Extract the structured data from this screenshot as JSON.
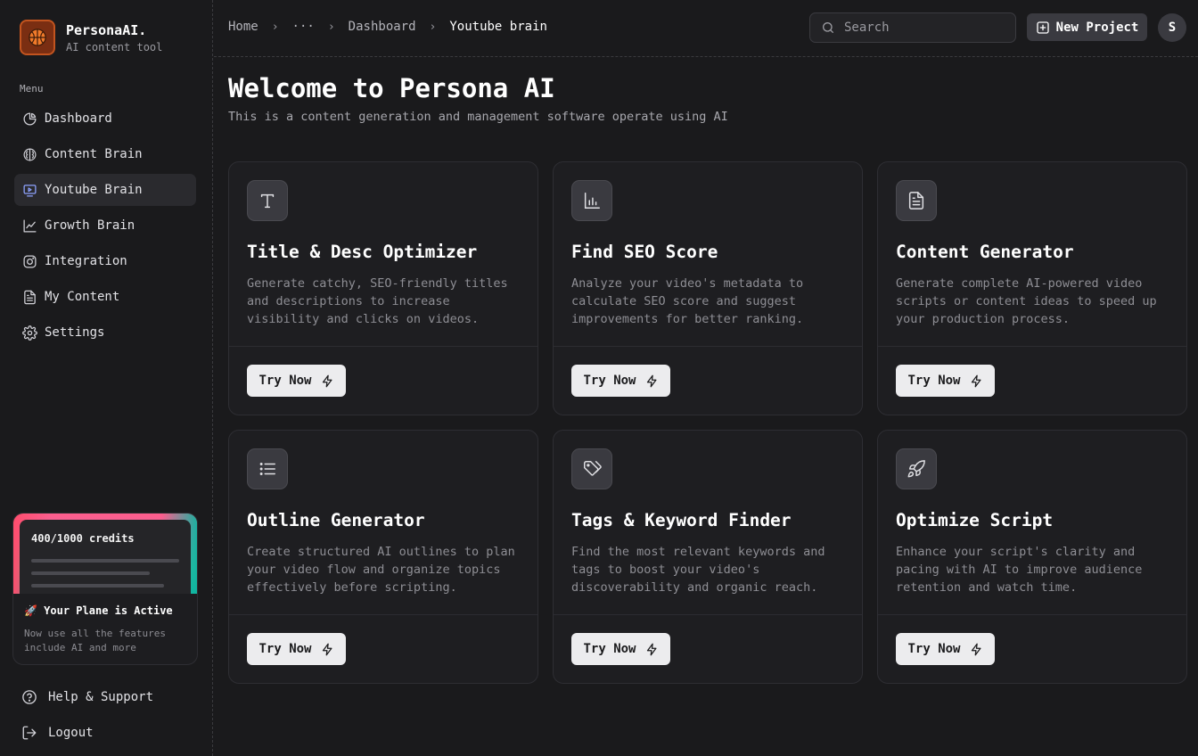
{
  "brand": {
    "name": "PersonaAI.",
    "subtitle": "AI content tool"
  },
  "sidebar": {
    "menu_heading": "Menu",
    "items": [
      {
        "label": "Dashboard",
        "icon": "pie-chart-icon",
        "active": false
      },
      {
        "label": "Content Brain",
        "icon": "brain-icon",
        "active": false
      },
      {
        "label": "Youtube Brain",
        "icon": "video-screen-icon",
        "active": true
      },
      {
        "label": "Growth Brain",
        "icon": "line-chart-icon",
        "active": false
      },
      {
        "label": "Integration",
        "icon": "instagram-icon",
        "active": false
      },
      {
        "label": "My Content",
        "icon": "document-icon",
        "active": false
      },
      {
        "label": "Settings",
        "icon": "gear-icon",
        "active": false
      }
    ],
    "credits": {
      "label": "400/1000 credits",
      "used_fraction": 0.4,
      "plan_title": "🚀 Your Plane is Active",
      "plan_desc": "Now use all the features include AI and more"
    },
    "bottom_items": [
      {
        "label": "Help & Support",
        "icon": "help-circle-icon"
      },
      {
        "label": "Logout",
        "icon": "logout-icon"
      }
    ]
  },
  "header": {
    "breadcrumb": [
      "Home",
      "···",
      "Dashboard",
      "Youtube brain"
    ],
    "search_placeholder": "Search",
    "new_project_label": "New Project",
    "avatar_initial": "S"
  },
  "main": {
    "title": "Welcome to Persona AI",
    "subtitle": "This is a content generation and management software operate using AI",
    "try_label": "Try Now",
    "cards": [
      {
        "title": "Title & Desc Optimizer",
        "desc": "Generate catchy, SEO-friendly titles and descriptions to increase visibility and clicks on videos.",
        "icon": "text-t-icon"
      },
      {
        "title": "Find SEO Score",
        "desc": "Analyze your video's metadata to calculate SEO score and suggest improvements for better ranking.",
        "icon": "bar-chart-icon"
      },
      {
        "title": "Content Generator",
        "desc": "Generate complete AI-powered video scripts or content ideas to speed up your production process.",
        "icon": "file-text-icon"
      },
      {
        "title": "Outline Generator",
        "desc": "Create structured AI outlines to plan your video flow and organize topics effectively before scripting.",
        "icon": "list-icon"
      },
      {
        "title": "Tags & Keyword Finder",
        "desc": "Find the most relevant keywords and tags to boost your video's discoverability and organic reach.",
        "icon": "tags-icon"
      },
      {
        "title": "Optimize Script",
        "desc": "Enhance your script's clarity and pacing with AI to improve audience retention and watch time.",
        "icon": "rocket-icon"
      }
    ]
  }
}
